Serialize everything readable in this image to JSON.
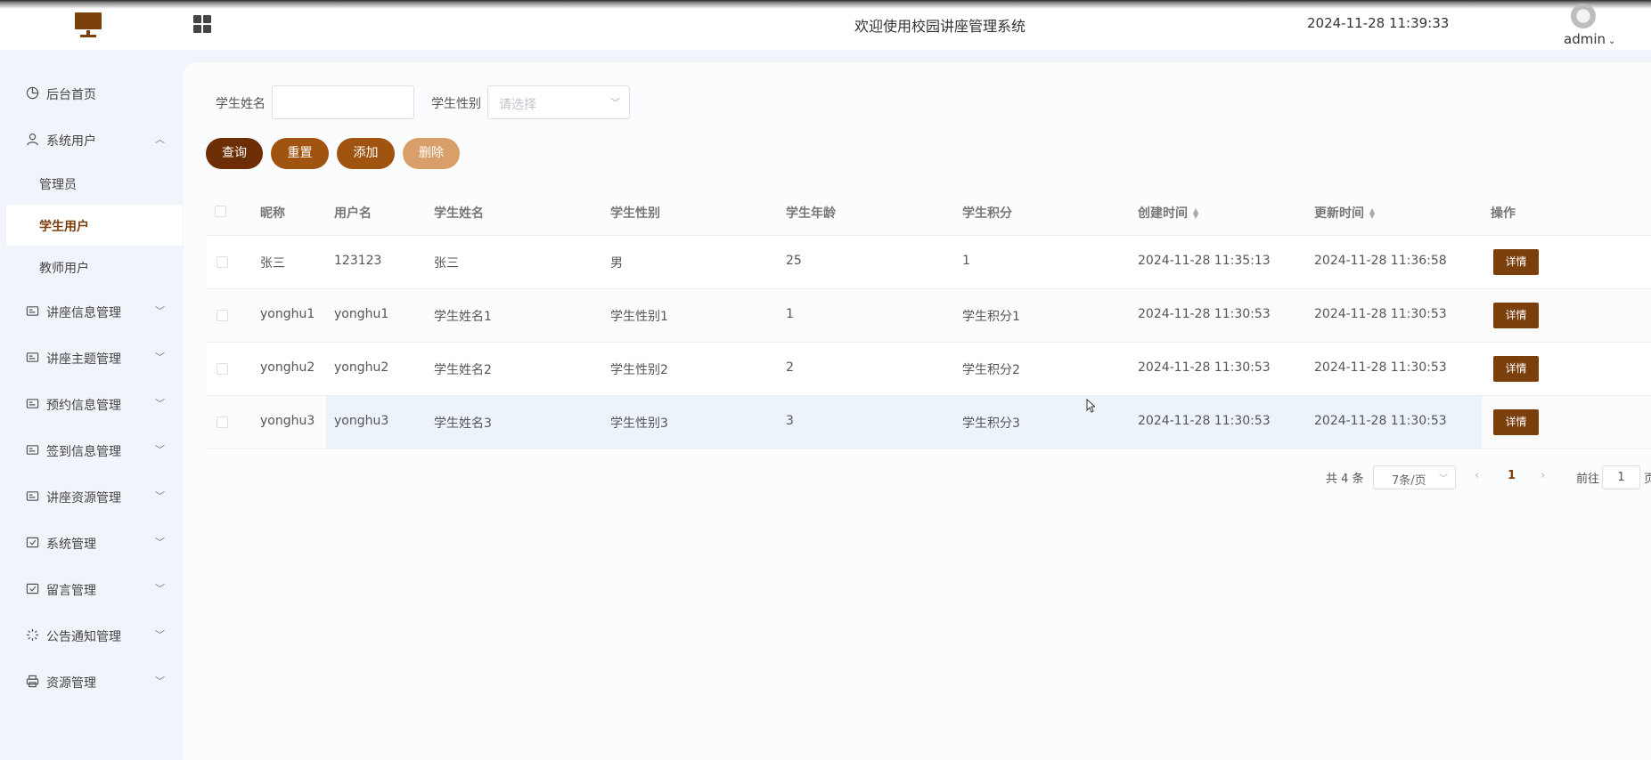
{
  "header": {
    "title": "欢迎使用校园讲座管理系统",
    "datetime": "2024-11-28 11:39:33",
    "user": "admin"
  },
  "sidebar": {
    "items": [
      {
        "label": "后台首页",
        "icon": "pie-chart-icon"
      },
      {
        "label": "系统用户",
        "icon": "user-icon",
        "expanded": true,
        "children": [
          {
            "label": "管理员"
          },
          {
            "label": "学生用户",
            "active": true
          },
          {
            "label": "教师用户"
          }
        ]
      },
      {
        "label": "讲座信息管理",
        "icon": "card-icon"
      },
      {
        "label": "讲座主题管理",
        "icon": "card-icon"
      },
      {
        "label": "预约信息管理",
        "icon": "card-icon"
      },
      {
        "label": "签到信息管理",
        "icon": "card-icon"
      },
      {
        "label": "讲座资源管理",
        "icon": "card-icon"
      },
      {
        "label": "系统管理",
        "icon": "check-square-icon"
      },
      {
        "label": "留言管理",
        "icon": "check-square-icon"
      },
      {
        "label": "公告通知管理",
        "icon": "loading-icon"
      },
      {
        "label": "资源管理",
        "icon": "printer-icon"
      }
    ]
  },
  "search": {
    "name_label": "学生姓名",
    "name_value": "",
    "gender_label": "学生性别",
    "gender_placeholder": "请选择"
  },
  "toolbar": {
    "query": "查询",
    "reset": "重置",
    "add": "添加",
    "delete": "删除"
  },
  "table": {
    "columns": [
      "昵称",
      "用户名",
      "学生姓名",
      "学生性别",
      "学生年龄",
      "学生积分",
      "创建时间",
      "更新时间",
      "操作"
    ],
    "rows": [
      [
        "张三",
        "123123",
        "张三",
        "男",
        "25",
        "1",
        "2024-11-28 11:35:13",
        "2024-11-28 11:36:58"
      ],
      [
        "yonghu1",
        "yonghu1",
        "学生姓名1",
        "学生性别1",
        "1",
        "学生积分1",
        "2024-11-28 11:30:53",
        "2024-11-28 11:30:53"
      ],
      [
        "yonghu2",
        "yonghu2",
        "学生姓名2",
        "学生性别2",
        "2",
        "学生积分2",
        "2024-11-28 11:30:53",
        "2024-11-28 11:30:53"
      ],
      [
        "yonghu3",
        "yonghu3",
        "学生姓名3",
        "学生性别3",
        "3",
        "学生积分3",
        "2024-11-28 11:30:53",
        "2024-11-28 11:30:53"
      ]
    ],
    "action_label": "详情"
  },
  "pagination": {
    "total": "共 4 条",
    "page_size": "7条/页",
    "current_page": "1",
    "goto_label": "前往",
    "goto_value": "1",
    "page_suffix": "页"
  },
  "colors": {
    "brand": "#7b3f0c",
    "query_button": "#6d2e06",
    "secondary_button": "#a0540f",
    "delete_button": "#d99f6a"
  }
}
